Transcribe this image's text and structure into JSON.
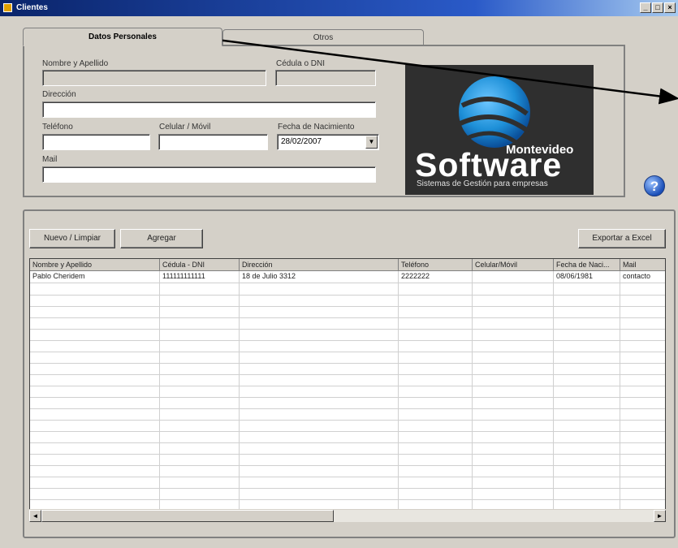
{
  "window": {
    "title": "Clientes",
    "controls": [
      "_",
      "□",
      "×"
    ]
  },
  "tabs": [
    {
      "label": "Datos Personales",
      "active": true
    },
    {
      "label": "Otros",
      "active": false
    }
  ],
  "form": {
    "nombre_label": "Nombre y Apellido",
    "cedula_label": "Cédula o DNI",
    "direccion_label": "Dirección",
    "telefono_label": "Teléfono",
    "celular_label": "Celular / Móvil",
    "fecha_label": "Fecha de Nacimiento",
    "fecha_value": "28/02/2007",
    "mail_label": "Mail"
  },
  "logo": {
    "top_text": "Montevideo",
    "main_text": "Software",
    "sub_text": "Sistemas de Gestión para empresas",
    "colors": {
      "background": "#2f2f2f",
      "globe": "#1e90d8"
    }
  },
  "help_icon": "question-mark",
  "buttons": {
    "nuevo": "Nuevo / Limpiar",
    "agregar": "Agregar",
    "exportar": "Exportar a Excel"
  },
  "table": {
    "columns": [
      "Nombre y Apellido",
      "Cédula - DNI",
      "Dirección",
      "Teléfono",
      "Celular/Móvil",
      "Fecha de Naci...",
      "Mail"
    ],
    "rows": [
      [
        "Pablo Cheridem",
        "111111111111",
        "18 de Julio 3312",
        "2222222",
        "",
        "08/06/1981",
        "contacto"
      ]
    ]
  },
  "scrollbar": {
    "left_arrow": "◄",
    "right_arrow": "►"
  }
}
